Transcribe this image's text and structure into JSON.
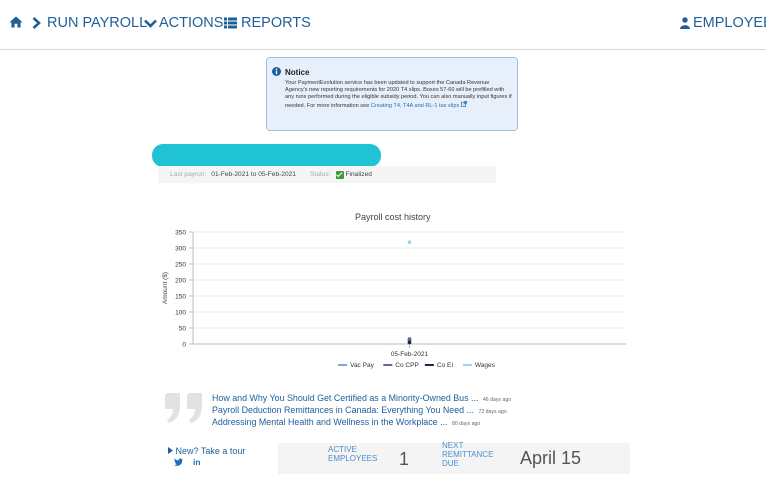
{
  "nav": {
    "run_payroll": "RUN PAYROLL",
    "actions": "ACTIONS",
    "reports": "REPORTS",
    "employees": "EMPLOYEES"
  },
  "notice": {
    "title": "Notice",
    "body": "Your PaymentEvolution service has been updated to support the Canada Revenue Agency's new reporting requirements for 2020 T4 slips. Boxes 57-60 will be prefilled with any runs performed during the eligible subsidy period. You can also manually input figures if needed. For more information see",
    "link": "Creating T4, T4A and RL-1 tax slips"
  },
  "last_payrun": {
    "label": "Last payrun:",
    "value": "01-Feb-2021 to 05-Feb-2021",
    "status_label": "Status:",
    "status_value": "Finalized"
  },
  "chart_data": {
    "type": "line",
    "title": "Payroll cost history",
    "xlabel": "",
    "ylabel": "Amount ($)",
    "categories": [
      "05-Feb-2021"
    ],
    "ylim": [
      0,
      350
    ],
    "yticks": [
      0,
      50,
      100,
      150,
      200,
      250,
      300,
      350
    ],
    "grid": true,
    "legend_position": "bottom",
    "series": [
      {
        "name": "Vac Pay",
        "values": [
          12
        ],
        "color": "#7aa7d9"
      },
      {
        "name": "Co CPP",
        "values": [
          15
        ],
        "color": "#5a6b8c"
      },
      {
        "name": "Co EI",
        "values": [
          5
        ],
        "color": "#1b2a4a"
      },
      {
        "name": "Wages",
        "values": [
          318
        ],
        "color": "#9fd4ea"
      }
    ]
  },
  "articles": [
    {
      "title": "How and Why You Should Get Certified as a Minority-Owned Bus ...",
      "age": "46 days ago"
    },
    {
      "title": "Payroll Deduction Remittances in Canada: Everything You Need ...",
      "age": "72 days ago"
    },
    {
      "title": "Addressing Mental Health and Wellness in the Workplace ...",
      "age": "80 days ago"
    }
  ],
  "tour": {
    "label": "New? Take a tour"
  },
  "stats": {
    "active_label_1": "ACTIVE",
    "active_label_2": "EMPLOYEES",
    "active_value": "1",
    "remit_label_1": "NEXT",
    "remit_label_2": "REMITTANCE",
    "remit_label_3": "DUE",
    "remit_value": "April 15"
  }
}
